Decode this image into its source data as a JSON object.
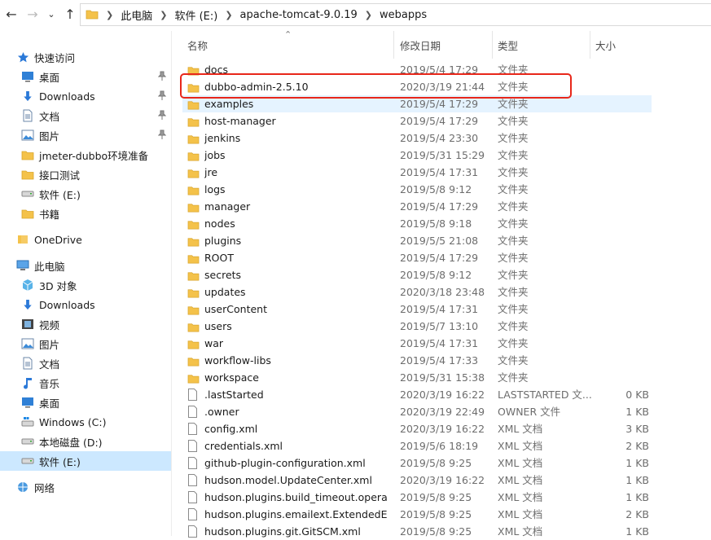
{
  "colors": {
    "folder": "#f4c24a",
    "selection": "#cce8ff",
    "hover": "#e5f3ff",
    "highlight_box": "#e8271a"
  },
  "breadcrumb": [
    "此电脑",
    "软件 (E:)",
    "apache-tomcat-9.0.19",
    "webapps"
  ],
  "columns": {
    "name": "名称",
    "date": "修改日期",
    "type": "类型",
    "size": "大小"
  },
  "sidebar": [
    {
      "label": "快速访问",
      "icon": "star-icon"
    },
    {
      "label": "桌面",
      "icon": "desktop-icon",
      "pinned": true
    },
    {
      "label": "Downloads",
      "icon": "download-icon",
      "pinned": true
    },
    {
      "label": "文档",
      "icon": "document-icon",
      "pinned": true
    },
    {
      "label": "图片",
      "icon": "picture-icon",
      "pinned": true
    },
    {
      "label": "jmeter-dubbo环境准备",
      "icon": "folder-icon"
    },
    {
      "label": "接口测试",
      "icon": "folder-icon"
    },
    {
      "label": "软件 (E:)",
      "icon": "drive-icon"
    },
    {
      "label": "书籍",
      "icon": "folder-icon"
    },
    {
      "label": "OneDrive",
      "icon": "cloud-icon"
    },
    {
      "label": "此电脑",
      "icon": "computer-icon"
    },
    {
      "label": "3D 对象",
      "icon": "cube-icon"
    },
    {
      "label": "Downloads",
      "icon": "download-icon"
    },
    {
      "label": "视频",
      "icon": "video-icon"
    },
    {
      "label": "图片",
      "icon": "picture-icon"
    },
    {
      "label": "文档",
      "icon": "document-icon"
    },
    {
      "label": "音乐",
      "icon": "music-icon"
    },
    {
      "label": "桌面",
      "icon": "desktop-icon"
    },
    {
      "label": "Windows (C:)",
      "icon": "windows-drive-icon"
    },
    {
      "label": "本地磁盘 (D:)",
      "icon": "drive-icon"
    },
    {
      "label": "软件 (E:)",
      "icon": "drive-icon",
      "selected": true
    },
    {
      "label": "网络",
      "icon": "network-icon"
    }
  ],
  "files": [
    {
      "name": "docs",
      "date": "2019/5/4 17:29",
      "type": "文件夹",
      "size": "",
      "kind": "folder"
    },
    {
      "name": "dubbo-admin-2.5.10",
      "date": "2020/3/19 21:44",
      "type": "文件夹",
      "size": "",
      "kind": "folder"
    },
    {
      "name": "examples",
      "date": "2019/5/4 17:29",
      "type": "文件夹",
      "size": "",
      "kind": "folder",
      "hover": true
    },
    {
      "name": "host-manager",
      "date": "2019/5/4 17:29",
      "type": "文件夹",
      "size": "",
      "kind": "folder"
    },
    {
      "name": "jenkins",
      "date": "2019/5/4 23:30",
      "type": "文件夹",
      "size": "",
      "kind": "folder"
    },
    {
      "name": "jobs",
      "date": "2019/5/31 15:29",
      "type": "文件夹",
      "size": "",
      "kind": "folder"
    },
    {
      "name": "jre",
      "date": "2019/5/4 17:31",
      "type": "文件夹",
      "size": "",
      "kind": "folder"
    },
    {
      "name": "logs",
      "date": "2019/5/8 9:12",
      "type": "文件夹",
      "size": "",
      "kind": "folder"
    },
    {
      "name": "manager",
      "date": "2019/5/4 17:29",
      "type": "文件夹",
      "size": "",
      "kind": "folder"
    },
    {
      "name": "nodes",
      "date": "2019/5/8 9:18",
      "type": "文件夹",
      "size": "",
      "kind": "folder"
    },
    {
      "name": "plugins",
      "date": "2019/5/5 21:08",
      "type": "文件夹",
      "size": "",
      "kind": "folder"
    },
    {
      "name": "ROOT",
      "date": "2019/5/4 17:29",
      "type": "文件夹",
      "size": "",
      "kind": "folder"
    },
    {
      "name": "secrets",
      "date": "2019/5/8 9:12",
      "type": "文件夹",
      "size": "",
      "kind": "folder"
    },
    {
      "name": "updates",
      "date": "2020/3/18 23:48",
      "type": "文件夹",
      "size": "",
      "kind": "folder"
    },
    {
      "name": "userContent",
      "date": "2019/5/4 17:31",
      "type": "文件夹",
      "size": "",
      "kind": "folder"
    },
    {
      "name": "users",
      "date": "2019/5/7 13:10",
      "type": "文件夹",
      "size": "",
      "kind": "folder"
    },
    {
      "name": "war",
      "date": "2019/5/4 17:31",
      "type": "文件夹",
      "size": "",
      "kind": "folder"
    },
    {
      "name": "workflow-libs",
      "date": "2019/5/4 17:33",
      "type": "文件夹",
      "size": "",
      "kind": "folder"
    },
    {
      "name": "workspace",
      "date": "2019/5/31 15:38",
      "type": "文件夹",
      "size": "",
      "kind": "folder"
    },
    {
      "name": ".lastStarted",
      "date": "2020/3/19 16:22",
      "type": "LASTSTARTED 文...",
      "size": "0 KB",
      "kind": "file"
    },
    {
      "name": ".owner",
      "date": "2020/3/19 22:49",
      "type": "OWNER 文件",
      "size": "1 KB",
      "kind": "file"
    },
    {
      "name": "config.xml",
      "date": "2020/3/19 16:22",
      "type": "XML 文档",
      "size": "3 KB",
      "kind": "file"
    },
    {
      "name": "credentials.xml",
      "date": "2019/5/6 18:19",
      "type": "XML 文档",
      "size": "2 KB",
      "kind": "file"
    },
    {
      "name": "github-plugin-configuration.xml",
      "date": "2019/5/8 9:25",
      "type": "XML 文档",
      "size": "1 KB",
      "kind": "file"
    },
    {
      "name": "hudson.model.UpdateCenter.xml",
      "date": "2020/3/19 16:22",
      "type": "XML 文档",
      "size": "1 KB",
      "kind": "file"
    },
    {
      "name": "hudson.plugins.build_timeout.operati...",
      "date": "2019/5/8 9:25",
      "type": "XML 文档",
      "size": "1 KB",
      "kind": "file"
    },
    {
      "name": "hudson.plugins.emailext.ExtendedEm...",
      "date": "2019/5/8 9:25",
      "type": "XML 文档",
      "size": "2 KB",
      "kind": "file"
    },
    {
      "name": "hudson.plugins.git.GitSCM.xml",
      "date": "2019/5/8 9:25",
      "type": "XML 文档",
      "size": "1 KB",
      "kind": "file"
    }
  ]
}
